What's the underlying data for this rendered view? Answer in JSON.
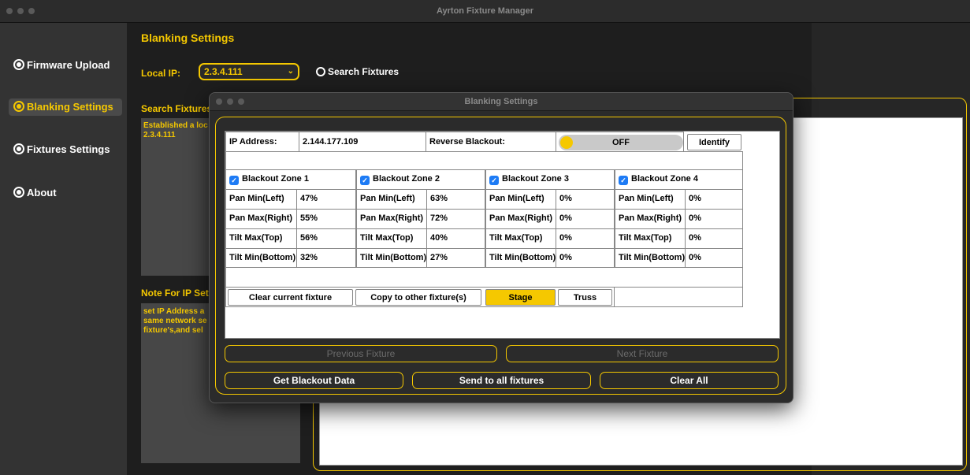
{
  "window": {
    "title": "Ayrton Fixture Manager"
  },
  "sidebar": {
    "items": [
      {
        "label": "Firmware Upload",
        "icon": "firmware-icon"
      },
      {
        "label": "Blanking Settings",
        "icon": "blanking-icon",
        "active": true
      },
      {
        "label": "Fixtures Settings",
        "icon": "gear-icon"
      },
      {
        "label": "About",
        "icon": "info-icon"
      }
    ]
  },
  "main": {
    "section_title": "Blanking Settings",
    "local_ip_label": "Local IP:",
    "local_ip_value": "2.3.4.111",
    "search_button": "Search Fixtures",
    "search_panel_title": "Search Fixtures",
    "search_log_line1": "Established a loc",
    "search_log_line2": "2.3.4.111",
    "note_title": "Note For IP Set",
    "note_line1": "set IP Address a",
    "note_line2": "same network se",
    "note_line3": "fixture's,and sel"
  },
  "dialog": {
    "title": "Blanking Settings",
    "ip_label": "IP Address:",
    "ip_value": "2.144.177.109",
    "reverse_label": "Reverse Blackout:",
    "reverse_state": "OFF",
    "identify_button": "Identify",
    "zones": [
      {
        "name": "Blackout Zone 1",
        "checked": true,
        "pan_min_label": "Pan Min(Left)",
        "pan_min": "47%",
        "pan_max_label": "Pan Max(Right)",
        "pan_max": "55%",
        "tilt_max_label": "Tilt Max(Top)",
        "tilt_max": "56%",
        "tilt_min_label": "Tilt Min(Bottom)",
        "tilt_min": "32%"
      },
      {
        "name": "Blackout Zone 2",
        "checked": true,
        "pan_min_label": "Pan Min(Left)",
        "pan_min": "63%",
        "pan_max_label": "Pan Max(Right)",
        "pan_max": "72%",
        "tilt_max_label": "Tilt Max(Top)",
        "tilt_max": "40%",
        "tilt_min_label": "Tilt Min(Bottom)",
        "tilt_min": "27%"
      },
      {
        "name": "Blackout Zone 3",
        "checked": true,
        "pan_min_label": "Pan Min(Left)",
        "pan_min": "0%",
        "pan_max_label": "Pan Max(Right)",
        "pan_max": "0%",
        "tilt_max_label": "Tilt Max(Top)",
        "tilt_max": "0%",
        "tilt_min_label": "Tilt Min(Bottom)",
        "tilt_min": "0%"
      },
      {
        "name": "Blackout Zone 4",
        "checked": true,
        "pan_min_label": "Pan Min(Left)",
        "pan_min": "0%",
        "pan_max_label": "Pan Max(Right)",
        "pan_max": "0%",
        "tilt_max_label": "Tilt Max(Top)",
        "tilt_max": "0%",
        "tilt_min_label": "Tilt Min(Bottom)",
        "tilt_min": "0%"
      }
    ],
    "clear_current_button": "Clear current fixture",
    "copy_button": "Copy to other fixture(s)",
    "stage_button": "Stage",
    "truss_button": "Truss",
    "prev_button": "Previous Fixture",
    "next_button": "Next Fixture",
    "get_data_button": "Get Blackout Data",
    "send_all_button": "Send to all fixtures",
    "clear_all_button": "Clear All"
  },
  "colors": {
    "accent": "#f5c800",
    "background": "#1e1e1e",
    "sidebar": "#333333"
  }
}
